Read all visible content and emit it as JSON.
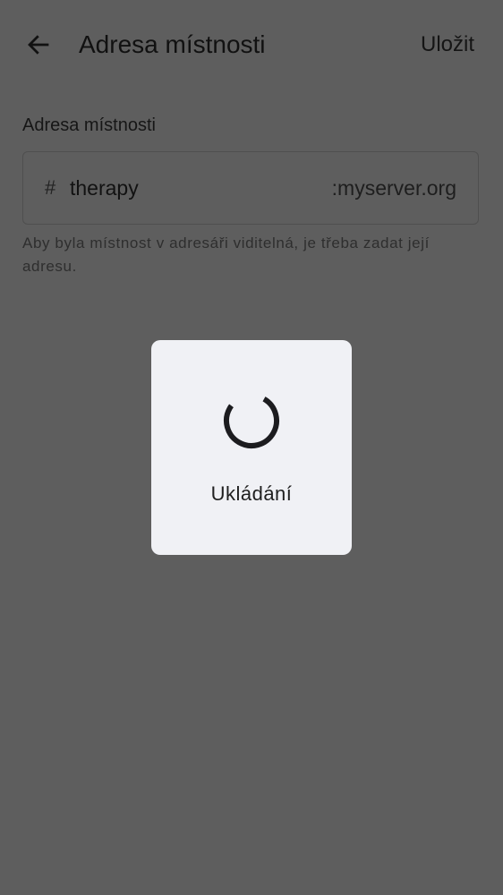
{
  "header": {
    "back_icon": "arrow-back-icon",
    "title": "Adresa místnosti",
    "save_label": "Uložit"
  },
  "address": {
    "label": "Adresa místnosti",
    "prefix": "#",
    "value": "therapy",
    "server": ":myserver.org",
    "helper": "Aby byla místnost v adresáři viditelná, je třeba zadat její adresu."
  },
  "dialog": {
    "icon": "spinner-icon",
    "message": "Ukládání"
  },
  "colors": {
    "scrim": "#5e5e5e",
    "dialog_background": "#f0f1f5"
  }
}
